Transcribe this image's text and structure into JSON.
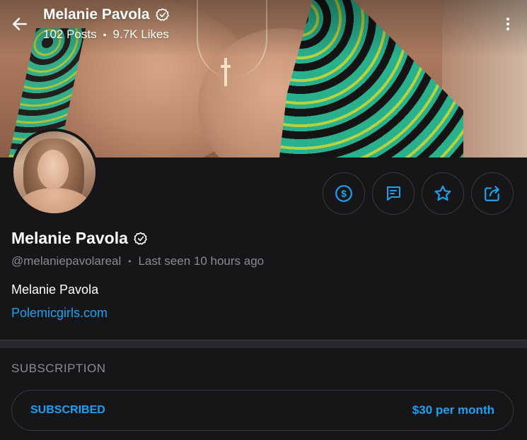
{
  "header": {
    "name": "Melanie Pavola",
    "posts": "102 Posts",
    "likes": "9.7K Likes",
    "separator": "•"
  },
  "profile": {
    "name": "Melanie Pavola",
    "username": "@melaniepavolareal",
    "separator": "•",
    "last_seen": "Last seen 10 hours ago",
    "bio": "Melanie Pavola",
    "link": "Polemicgirls.com"
  },
  "actions": {
    "tip_icon": "dollar-circle-icon",
    "message_icon": "message-icon",
    "favorite_icon": "star-icon",
    "share_icon": "share-icon"
  },
  "subscription": {
    "title": "SUBSCRIPTION",
    "status": "SUBSCRIBED",
    "price": "$30 per month"
  },
  "colors": {
    "accent": "#1da1f2",
    "background": "#161618",
    "muted": "#8a8a90",
    "border": "#3a3a3e"
  }
}
